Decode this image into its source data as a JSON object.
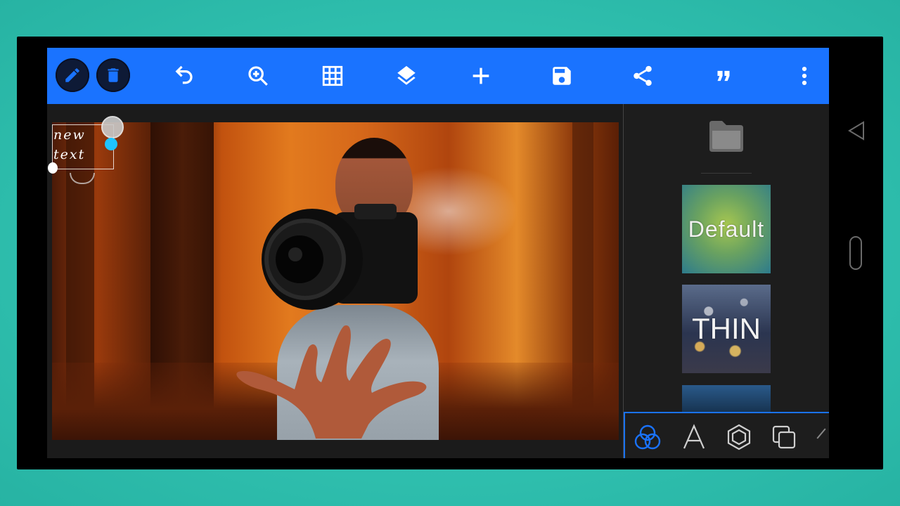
{
  "toolbar": {
    "background": "#1a73ff",
    "buttons": [
      {
        "name": "pencil-icon"
      },
      {
        "name": "trash-icon"
      },
      {
        "name": "undo-icon"
      },
      {
        "name": "zoom-in-icon"
      },
      {
        "name": "grid-icon"
      },
      {
        "name": "layers-icon"
      },
      {
        "name": "add-icon"
      },
      {
        "name": "save-icon"
      },
      {
        "name": "share-icon"
      },
      {
        "name": "quote-icon"
      },
      {
        "name": "more-vertical-icon"
      }
    ]
  },
  "canvas": {
    "text_object": "new\ntext"
  },
  "side_panel": {
    "folder_icon": "folder-icon",
    "styles": [
      {
        "label": "Default"
      },
      {
        "label": "THIN"
      }
    ]
  },
  "bottom_tabs": [
    {
      "name": "blend-icon",
      "active": true,
      "accent": "#1a73ff"
    },
    {
      "name": "font-icon"
    },
    {
      "name": "shape-icon"
    },
    {
      "name": "copy-layers-icon"
    }
  ],
  "system_nav": {
    "back": "back-triangle-icon",
    "home": "home-pill-icon"
  }
}
